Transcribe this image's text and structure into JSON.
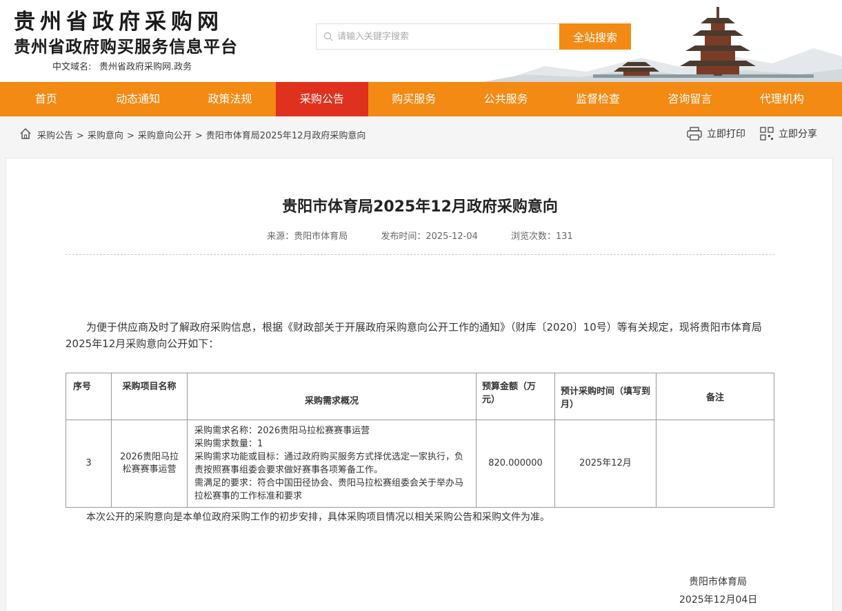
{
  "logo": {
    "line1": "贵州省政府采购网",
    "line2": "贵州省政府购买服务信息平台",
    "domain_label": "中文域名:",
    "domain_value": "贵州省政府采购网.政务"
  },
  "search": {
    "placeholder": "请输入关键字搜索",
    "button": "全站搜索"
  },
  "nav": {
    "items": [
      "首页",
      "动态通知",
      "政策法规",
      "采购公告",
      "购买服务",
      "公共服务",
      "监督检查",
      "咨询留言",
      "代理机构"
    ],
    "active_index": 3
  },
  "breadcrumb": {
    "items": [
      "采购公告",
      "采购意向",
      "采购意向公开",
      "贵阳市体育局2025年12月政府采购意向"
    ],
    "separator": ">"
  },
  "tools": {
    "print": "立即打印",
    "share": "立即分享"
  },
  "article": {
    "title": "贵阳市体育局2025年12月政府采购意向",
    "source": "来源：贵阳市体育局",
    "publish_time": "发布时间：2025-12-04",
    "views": "浏览次数：131",
    "intro": "为便于供应商及时了解政府采购信息，根据《财政部关于开展政府采购意向公开工作的通知》（财库〔2020〕10号）等有关规定，现将贵阳市体育局2025年12月采购意向公开如下：",
    "table": {
      "headers": [
        "序号",
        "采购项目名称",
        "采购需求概况",
        "预算金额（万元）",
        "预计采购时间（填写到月）",
        "备注"
      ],
      "rows": [
        {
          "no": "3",
          "name": "2026贵阳马拉松赛赛事运营",
          "desc": [
            "采购需求名称：2026贵阳马拉松赛赛事运营",
            "采购需求数量：1",
            "采购需求功能或目标：通过政府购买服务方式择优选定一家执行，负责按照赛事组委会要求做好赛事各项筹备工作。",
            "需满足的要求：符合中国田径协会、贵阳马拉松赛组委会关于举办马拉松赛事的工作标准和要求"
          ],
          "budget": "820.000000",
          "time": "2025年12月",
          "remark": ""
        }
      ]
    },
    "note": "本次公开的采购意向是本单位政府采购工作的初步安排，具体采购项目情况以相关采购公告和采购文件为准。",
    "signature": "贵阳市体育局",
    "date": "2025年12月04日"
  },
  "colors": {
    "nav_bg": "#f28a13",
    "nav_active": "#e0301e",
    "search_button": "#f28a13"
  }
}
